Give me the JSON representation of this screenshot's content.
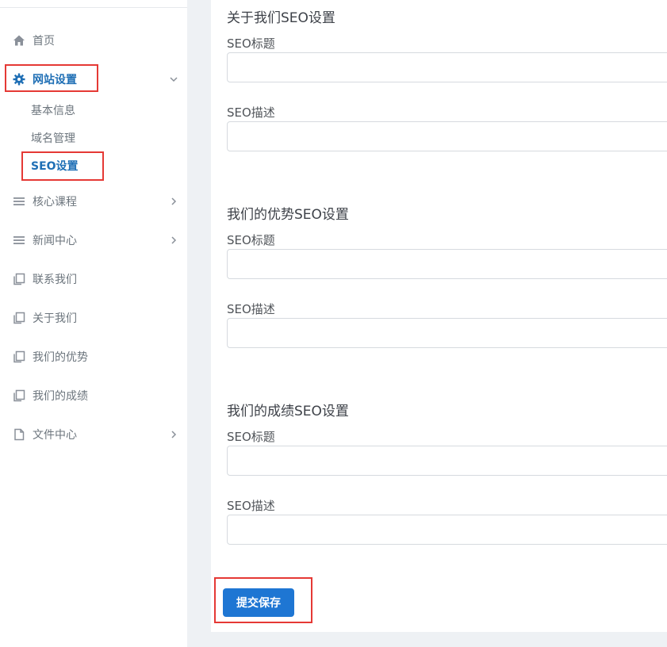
{
  "sidebar": {
    "items": [
      {
        "label": "首页",
        "icon": "home-icon"
      },
      {
        "label": "网站设置",
        "icon": "gear-icon",
        "active": true,
        "expanded": true
      },
      {
        "label": "核心课程",
        "icon": "menu-icon"
      },
      {
        "label": "新闻中心",
        "icon": "menu-icon"
      },
      {
        "label": "联系我们",
        "icon": "pages-icon"
      },
      {
        "label": "关于我们",
        "icon": "pages-icon"
      },
      {
        "label": "我们的优势",
        "icon": "pages-icon"
      },
      {
        "label": "我们的成绩",
        "icon": "pages-icon"
      },
      {
        "label": "文件中心",
        "icon": "file-icon"
      }
    ],
    "subitems": [
      {
        "label": "基本信息"
      },
      {
        "label": "域名管理"
      },
      {
        "label": "SEO设置",
        "active": true
      }
    ]
  },
  "main": {
    "sections": [
      {
        "title": "关于我们SEO设置",
        "title_label": "SEO标题",
        "desc_label": "SEO描述",
        "title_value": "",
        "desc_value": ""
      },
      {
        "title": "我们的优势SEO设置",
        "title_label": "SEO标题",
        "desc_label": "SEO描述",
        "title_value": "",
        "desc_value": ""
      },
      {
        "title": "我们的成绩SEO设置",
        "title_label": "SEO标题",
        "desc_label": "SEO描述",
        "title_value": "",
        "desc_value": ""
      }
    ],
    "submit_label": "提交保存"
  },
  "colors": {
    "accent": "#1e76d3",
    "active_text": "#1f6fb5",
    "highlight_box": "#e53935",
    "background": "#eef1f4"
  }
}
